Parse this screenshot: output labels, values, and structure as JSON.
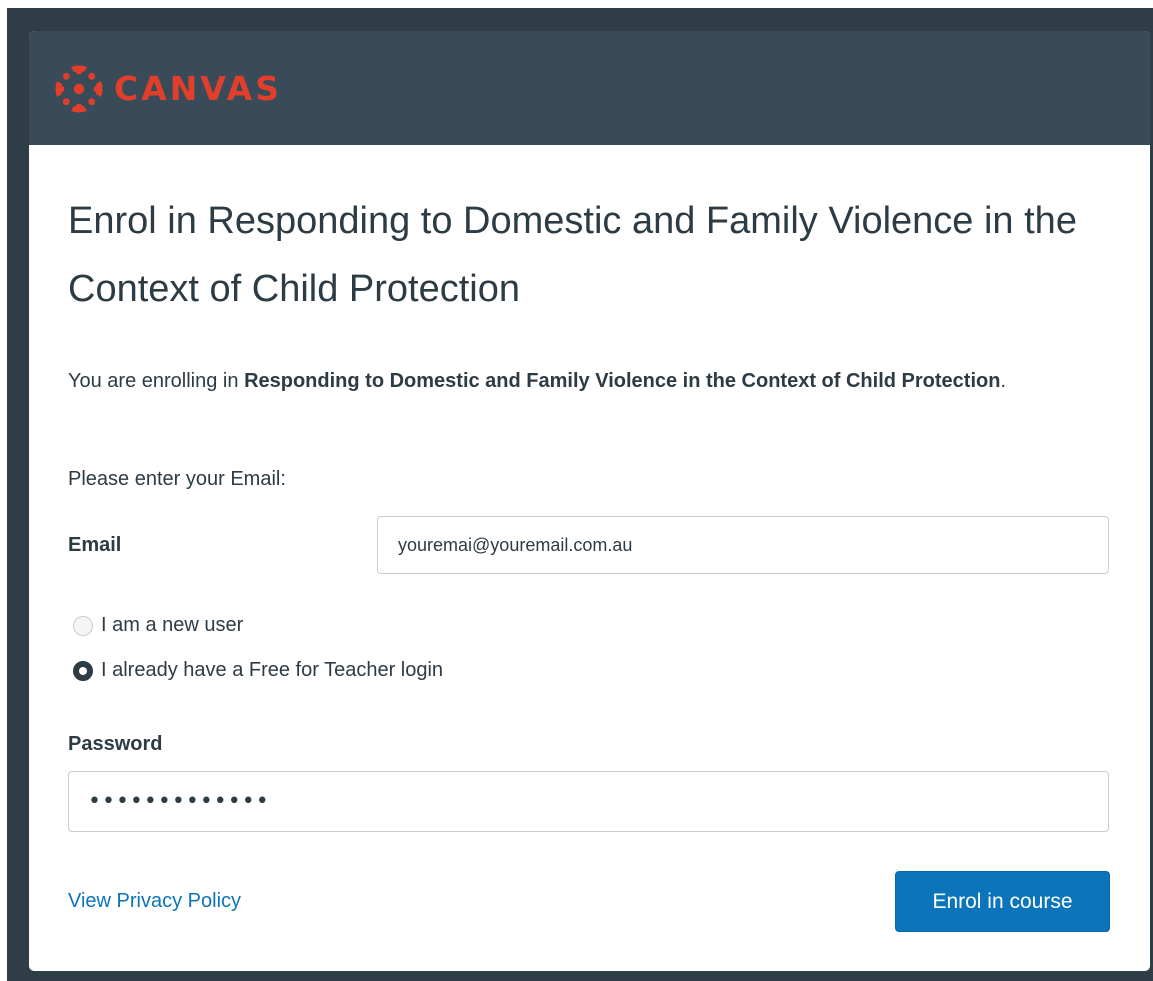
{
  "brand": {
    "name": "CANVAS",
    "logo_icon": "canvas-logo-icon",
    "color": "#e13f2b"
  },
  "colors": {
    "header_bg": "#394b58",
    "backdrop": "#2f3d47",
    "link": "#0b74bb",
    "primary_button": "#0b74bb",
    "text": "#2d3b45"
  },
  "page": {
    "title": "Enrol in Responding to Domestic and Family Violence in the Context of Child Protection"
  },
  "intro": {
    "prefix": "You are enrolling in ",
    "course_name": "Responding to Domestic and Family Violence in the Context of Child Protection",
    "suffix": "."
  },
  "form": {
    "prompt": "Please enter your Email:",
    "email_label": "Email",
    "email_value": "youremai@youremail.com.au",
    "user_options": [
      {
        "label": "I am a new user",
        "selected": false
      },
      {
        "label": "I already have a Free for Teacher login",
        "selected": true
      }
    ],
    "password_label": "Password",
    "password_masked": "•••••••••••••"
  },
  "footer": {
    "privacy_link": "View Privacy Policy",
    "submit_label": "Enrol in course"
  }
}
